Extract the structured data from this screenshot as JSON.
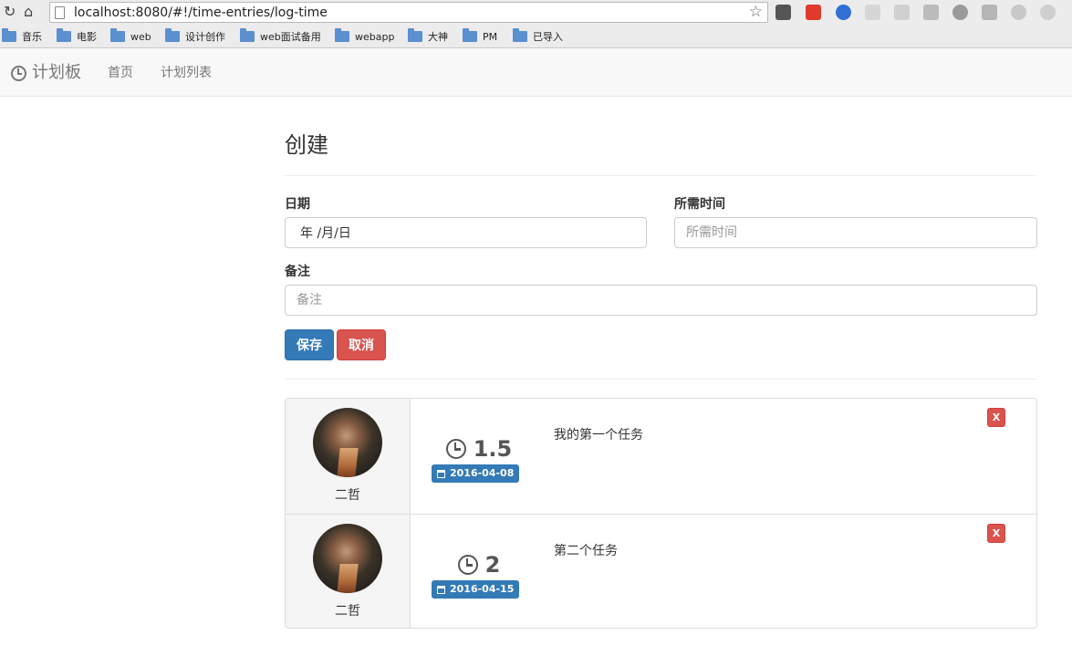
{
  "browser": {
    "url": "localhost:8080/#!/time-entries/log-time",
    "bookmarks": [
      "音乐",
      "电影",
      "web",
      "设计创作",
      "web面试备用",
      "webapp",
      "大神",
      "PM",
      "已导入"
    ]
  },
  "navbar": {
    "brand": "计划板",
    "links": [
      "首页",
      "计划列表"
    ]
  },
  "form": {
    "title": "创建",
    "date_label": "日期",
    "date_value": "年 /月/日",
    "duration_label": "所需时间",
    "duration_placeholder": "所需时间",
    "comment_label": "备注",
    "comment_placeholder": "备注",
    "save_label": "保存",
    "cancel_label": "取消"
  },
  "entries": [
    {
      "user": "二哲",
      "hours": "1.5",
      "date": "2016-04-08",
      "comment": "我的第一个任务",
      "delete_label": "X"
    },
    {
      "user": "二哲",
      "hours": "2",
      "date": "2016-04-15",
      "comment": "第二个任务",
      "delete_label": "X"
    }
  ],
  "colors": {
    "primary": "#337ab7",
    "danger": "#d9534f",
    "navbar_bg": "#f8f8f8"
  }
}
